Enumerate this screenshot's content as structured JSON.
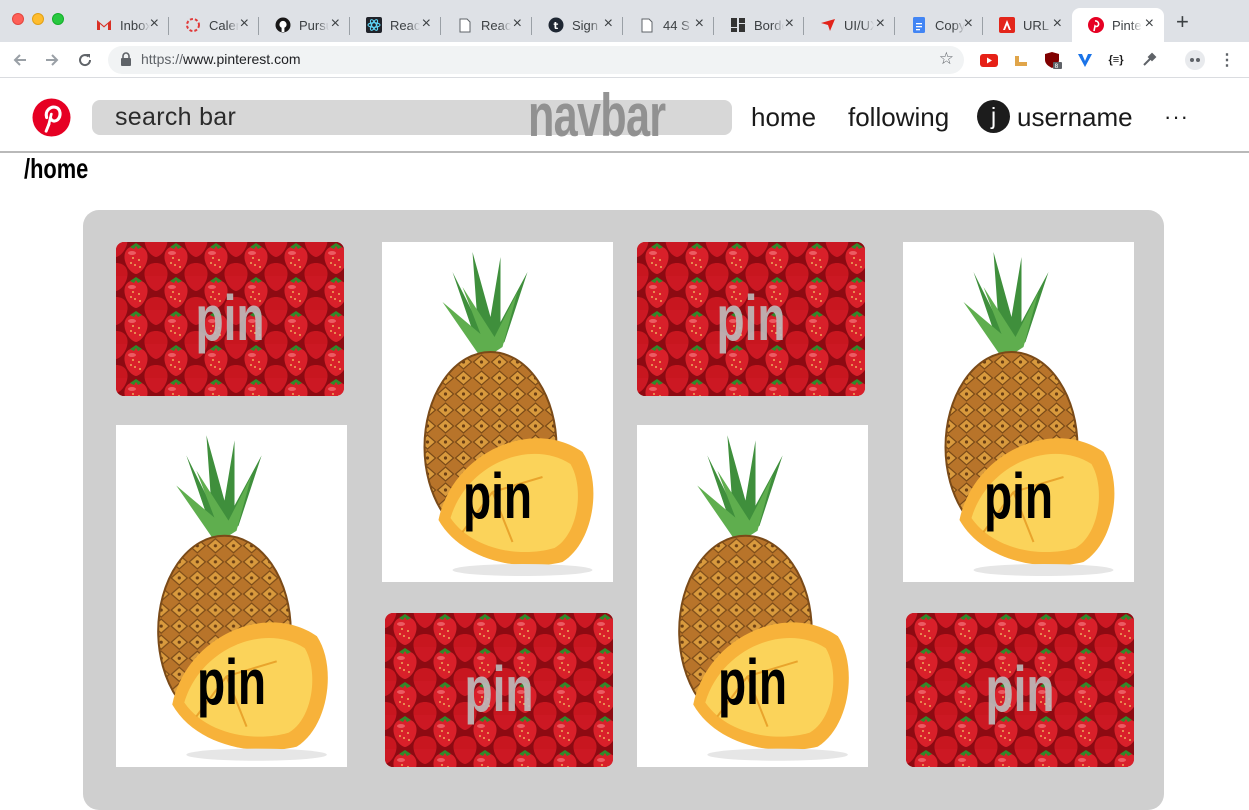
{
  "browser": {
    "tabs": [
      {
        "title": "Inbox",
        "icon": "gmail-icon"
      },
      {
        "title": "Calendar",
        "icon": "calendar-icon"
      },
      {
        "title": "Pursuit",
        "icon": "github-icon"
      },
      {
        "title": "React",
        "icon": "react-icon"
      },
      {
        "title": "React",
        "icon": "document-icon"
      },
      {
        "title": "Sign",
        "icon": "sign-icon"
      },
      {
        "title": "44 S",
        "icon": "document-icon"
      },
      {
        "title": "Border",
        "icon": "grid-icon"
      },
      {
        "title": "UI/UX",
        "icon": "bookmark-icon"
      },
      {
        "title": "Copy",
        "icon": "docs-icon"
      },
      {
        "title": "URL",
        "icon": "adobe-icon"
      },
      {
        "title": "Pinterest",
        "icon": "pinterest-icon"
      }
    ],
    "address": {
      "scheme": "https://",
      "host": "www.pinterest.com"
    }
  },
  "navbar": {
    "search_placeholder": "search bar",
    "label": "navbar",
    "home": "home",
    "following": "following",
    "avatar_letter": "j",
    "username": "username",
    "more": "···"
  },
  "route": "/home",
  "pins": [
    {
      "label": "pin",
      "image": "strawberries"
    },
    {
      "label": "pin",
      "image": "pineapple"
    },
    {
      "label": "pin",
      "image": "strawberries"
    },
    {
      "label": "pin",
      "image": "pineapple"
    },
    {
      "label": "pin",
      "image": "pineapple"
    },
    {
      "label": "pin",
      "image": "pineapple"
    },
    {
      "label": "pin",
      "image": "strawberries"
    },
    {
      "label": "pin",
      "image": "strawberries"
    }
  ]
}
